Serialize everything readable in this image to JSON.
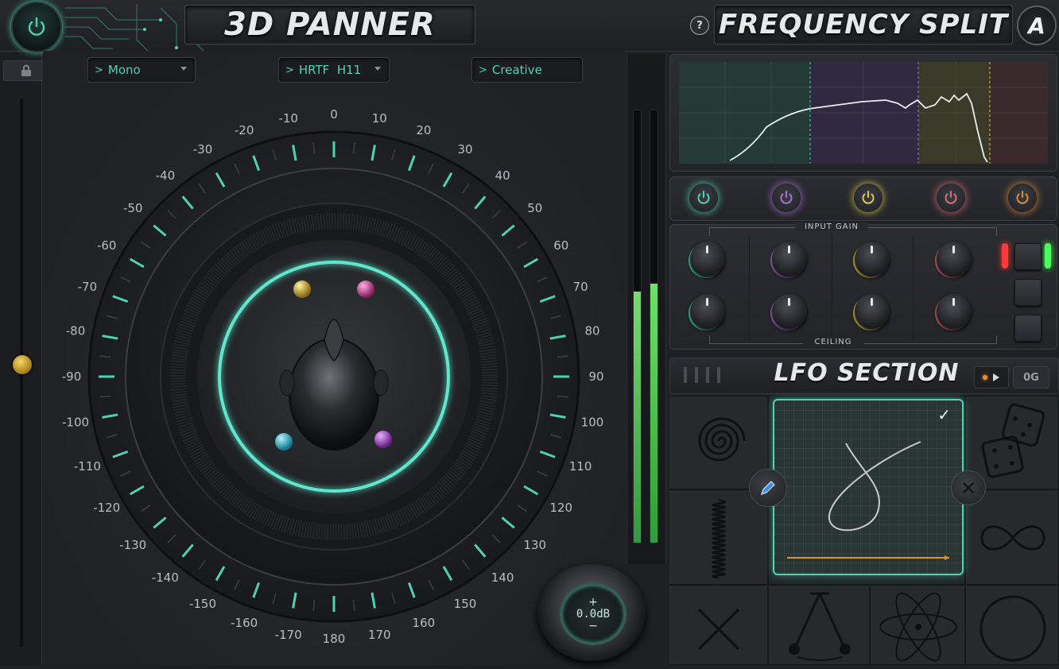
{
  "panner": {
    "title": "3D PANNER",
    "mode_dropdown": "Mono",
    "hrtf_dropdown": "HRTF  H11",
    "preset_dropdown": "Creative",
    "dial_ticks": [
      "0",
      "10",
      "20",
      "30",
      "40",
      "50",
      "60",
      "70",
      "80",
      "90",
      "100",
      "110",
      "120",
      "130",
      "140",
      "150",
      "160",
      "170",
      "180",
      "170",
      "160",
      "150",
      "140",
      "130",
      "120",
      "110",
      "100",
      "90",
      "80",
      "70",
      "60",
      "50",
      "40",
      "30",
      "20",
      "10"
    ],
    "dial_tick_negatives": [
      "0",
      "10",
      "20",
      "30",
      "40",
      "50",
      "60",
      "70",
      "80",
      "90",
      "100",
      "110",
      "120",
      "130",
      "140",
      "150",
      "160",
      "170",
      "180",
      "-170",
      "-160",
      "-150",
      "-140",
      "-130",
      "-120",
      "-110",
      "-100",
      "-90",
      "-80",
      "-70",
      "-60",
      "-50",
      "-40",
      "-30",
      "-20",
      "-10"
    ],
    "output_gain": "0.0dB",
    "gain_plus": "+",
    "gain_minus": "−",
    "meter_left_level": 0.58,
    "meter_right_level": 0.6
  },
  "frequency_split": {
    "title": "FREQUENCY SPLIT",
    "help_label": "?",
    "logo_letter": "A",
    "band_colors": [
      "#4fd1b3",
      "#b06ad8",
      "#e0c84a",
      "#e06a78",
      "#e0893a"
    ],
    "input_gain_label": "INPUT GAIN",
    "ceiling_label": "CEILING"
  },
  "lfo": {
    "title": "LFO SECTION",
    "og_label": "0G",
    "check_mark": "✓",
    "shapes": [
      "spiral",
      "dice",
      "spring",
      "infinity",
      "cross",
      "pendulum",
      "atom",
      "circle"
    ]
  },
  "colors": {
    "accent": "#4fd1b3",
    "gold": "#d7b43a",
    "orange": "#e6922a",
    "meter_green": "#3fbf4f"
  }
}
